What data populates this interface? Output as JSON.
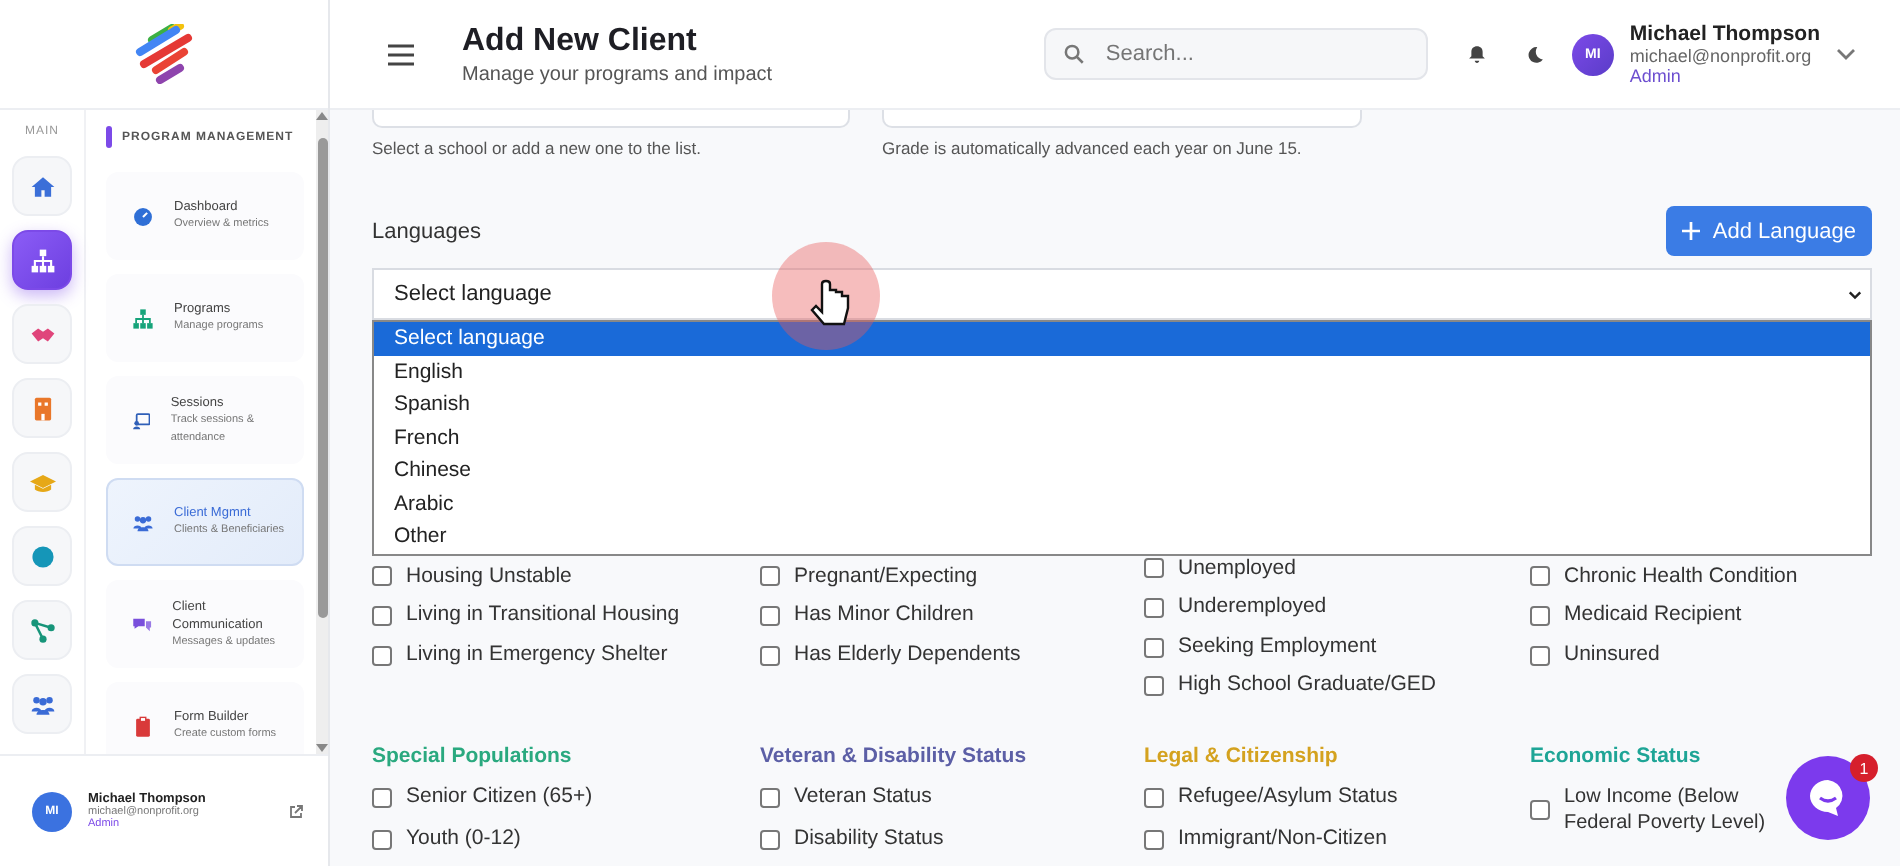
{
  "sidebar": {
    "rail_label": "MAIN",
    "rail_items": [
      {
        "selected": false
      },
      {
        "selected": true
      },
      {
        "selected": false
      },
      {
        "selected": false
      },
      {
        "selected": false
      },
      {
        "selected": false
      },
      {
        "selected": false
      },
      {
        "selected": false
      }
    ],
    "section_title": "PROGRAM MANAGEMENT",
    "nav_items": [
      {
        "title": "Dashboard",
        "subtitle": "Overview & metrics",
        "selected": false
      },
      {
        "title": "Programs",
        "subtitle": "Manage programs",
        "selected": false
      },
      {
        "title": "Sessions",
        "subtitle": "Track sessions & attendance",
        "selected": false
      },
      {
        "title": "Client Mgmnt",
        "subtitle": "Clients & Beneficiaries",
        "selected": true
      },
      {
        "title": "Client Communication",
        "subtitle": "Messages & updates",
        "selected": false
      },
      {
        "title": "Form Builder",
        "subtitle": "Create custom forms",
        "selected": false
      }
    ],
    "user": {
      "initials": "MI",
      "name": "Michael Thompson",
      "email": "michael@nonprofit.org",
      "role": "Admin"
    }
  },
  "header": {
    "title": "Add New Client",
    "subtitle": "Manage your programs and impact",
    "search": {
      "placeholder": "Search..."
    },
    "user": {
      "initials": "MI",
      "name": "Michael Thompson",
      "email": "michael@nonprofit.org",
      "role": "Admin"
    }
  },
  "form": {
    "helpers": [
      "Select a school or add a new one to the list.",
      "Grade is automatically advanced each year on June 15."
    ],
    "languages": {
      "label": "Languages",
      "add_button": "Add Language",
      "select_value": "Select language",
      "options": [
        {
          "label": "Select language",
          "selected": true
        },
        {
          "label": "English",
          "selected": false
        },
        {
          "label": "Spanish",
          "selected": false
        },
        {
          "label": "French",
          "selected": false
        },
        {
          "label": "Chinese",
          "selected": false
        },
        {
          "label": "Arabic",
          "selected": false
        },
        {
          "label": "Other",
          "selected": false
        }
      ]
    },
    "groups_top": [
      {
        "items": [
          {
            "label": "Housing Unstable",
            "checked": false
          },
          {
            "label": "Living in Transitional Housing",
            "checked": false
          },
          {
            "label": "Living in Emergency Shelter",
            "checked": false
          }
        ]
      },
      {
        "items": [
          {
            "label": "Pregnant/Expecting",
            "checked": false
          },
          {
            "label": "Has Minor Children",
            "checked": false
          },
          {
            "label": "Has Elderly Dependents",
            "checked": false
          }
        ]
      },
      {
        "items": [
          {
            "label": "Unemployed",
            "checked": false
          },
          {
            "label": "Underemployed",
            "checked": false
          },
          {
            "label": "Seeking Employment",
            "checked": false
          },
          {
            "label": "High School Graduate/GED",
            "checked": false
          }
        ]
      },
      {
        "items": [
          {
            "label": "Chronic Health Condition",
            "checked": false
          },
          {
            "label": "Medicaid Recipient",
            "checked": false
          },
          {
            "label": "Uninsured",
            "checked": false
          }
        ]
      }
    ],
    "groups": [
      {
        "title": "Special Populations",
        "color": "#2aa97f",
        "items": [
          {
            "label": "Senior Citizen (65+)",
            "checked": false
          },
          {
            "label": "Youth (0-12)",
            "checked": false
          }
        ]
      },
      {
        "title": "Veteran & Disability Status",
        "color": "#5c5fa6",
        "items": [
          {
            "label": "Veteran Status",
            "checked": false
          },
          {
            "label": "Disability Status",
            "checked": false
          }
        ]
      },
      {
        "title": "Legal & Citizenship",
        "color": "#d4a21f",
        "items": [
          {
            "label": "Refugee/Asylum Status",
            "checked": false
          },
          {
            "label": "Immigrant/Non-Citizen",
            "checked": false
          }
        ]
      },
      {
        "title": "Economic Status",
        "color": "#1ea596",
        "items": [
          {
            "label": "Low Income (Below Federal Poverty Level)",
            "checked": false
          }
        ]
      }
    ]
  },
  "chat": {
    "badge": "1"
  }
}
